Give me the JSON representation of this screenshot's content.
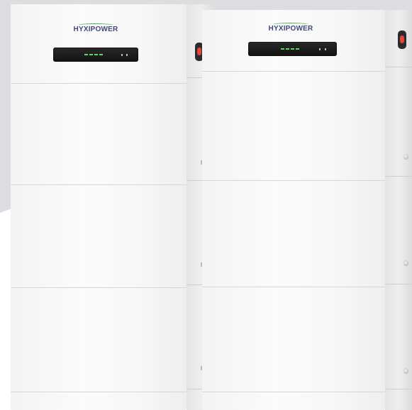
{
  "scene": {
    "background": "#dcdde0",
    "foreground_white": "#ffffff",
    "cabinet_color": "#f7f7f7",
    "brand_color": "#3f4a7a",
    "accent_green": "#4caf50",
    "display_led_color": "#5cd65c",
    "switch_color": "#e0453e"
  },
  "units": [
    {
      "name": "left",
      "brand_text": "HYXIPOWER",
      "display_icon": "status-display-icon",
      "switch_icon": "power-switch-icon"
    },
    {
      "name": "right",
      "brand_text": "HYXIPOWER",
      "display_icon": "status-display-icon",
      "switch_icon": "power-switch-icon"
    }
  ]
}
